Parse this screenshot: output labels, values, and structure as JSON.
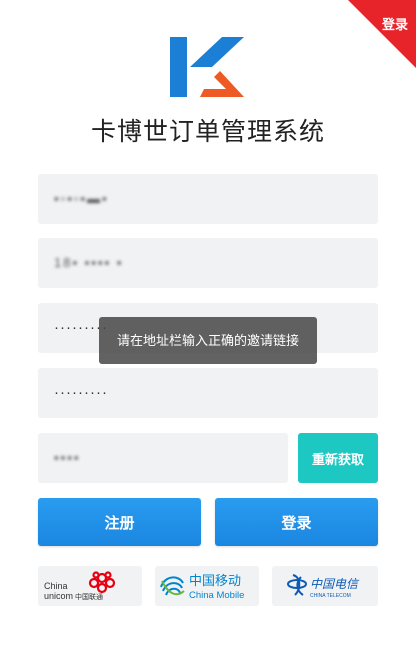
{
  "corner": {
    "label": "登录"
  },
  "app": {
    "title": "卡博世订单管理系统"
  },
  "form": {
    "field1_value": "▪▫▪▫▪▬▪",
    "field2_value": "18▪ ▪▪▪▪ ▪",
    "field3_value": "·········",
    "field4_value": "·········",
    "field5_value": "▪▪▪▪"
  },
  "buttons": {
    "get_code": "重新获取",
    "register": "注册",
    "login": "登录"
  },
  "toast": {
    "message": "请在地址栏输入正确的邀请链接"
  },
  "carriers": {
    "unicom_en_1": "China",
    "unicom_en_2": "unicom",
    "unicom_cn": "中国联通",
    "mobile_cn": "中国移动",
    "mobile_en": "China Mobile",
    "telecom_cn": "中国电信",
    "telecom_en": "CHINA TELECOM"
  },
  "colors": {
    "corner_red": "#e8242b",
    "logo_blue": "#1b7fd6",
    "logo_orange": "#ee5a24",
    "teal_button": "#1ec8c2",
    "primary_blue": "#1a86e0"
  }
}
